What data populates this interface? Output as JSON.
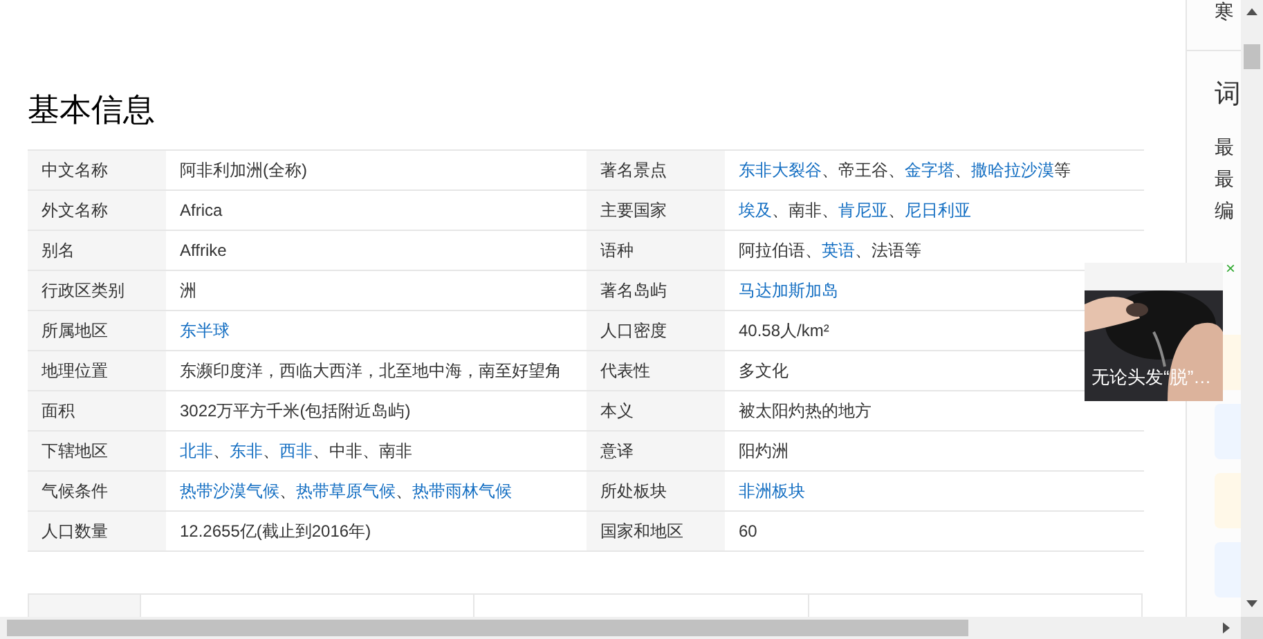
{
  "section_title": "基本信息",
  "info_rows": [
    {
      "left": {
        "label": "中文名称",
        "value": [
          {
            "text": "阿非利加洲(全称)",
            "link": false
          }
        ]
      },
      "right": {
        "label": "著名景点",
        "value": [
          {
            "text": "东非大裂谷",
            "link": true
          },
          {
            "text": "、帝王谷、",
            "link": false
          },
          {
            "text": "金字塔",
            "link": true
          },
          {
            "text": "、",
            "link": false
          },
          {
            "text": "撒哈拉沙漠",
            "link": true
          },
          {
            "text": "等",
            "link": false
          }
        ]
      }
    },
    {
      "left": {
        "label": "外文名称",
        "value": [
          {
            "text": "Africa",
            "link": false
          }
        ]
      },
      "right": {
        "label": "主要国家",
        "value": [
          {
            "text": "埃及",
            "link": true
          },
          {
            "text": "、南非、",
            "link": false
          },
          {
            "text": "肯尼亚",
            "link": true
          },
          {
            "text": "、",
            "link": false
          },
          {
            "text": "尼日利亚",
            "link": true
          }
        ]
      }
    },
    {
      "left": {
        "label": "别名",
        "value": [
          {
            "text": "Affrike",
            "link": false
          }
        ]
      },
      "right": {
        "label": "语种",
        "value": [
          {
            "text": "阿拉伯语、",
            "link": false
          },
          {
            "text": "英语",
            "link": true
          },
          {
            "text": "、法语等",
            "link": false
          }
        ]
      }
    },
    {
      "left": {
        "label": "行政区类别",
        "value": [
          {
            "text": "洲",
            "link": false
          }
        ]
      },
      "right": {
        "label": "著名岛屿",
        "value": [
          {
            "text": "马达加斯加岛",
            "link": true
          }
        ]
      }
    },
    {
      "left": {
        "label": "所属地区",
        "value": [
          {
            "text": "东半球",
            "link": true
          }
        ]
      },
      "right": {
        "label": "人口密度",
        "value": [
          {
            "text": "40.58人/km²",
            "link": false
          }
        ]
      }
    },
    {
      "left": {
        "label": "地理位置",
        "value": [
          {
            "text": "东濒印度洋，西临大西洋，北至地中海，南至好望角",
            "link": false
          }
        ]
      },
      "right": {
        "label": "代表性",
        "value": [
          {
            "text": "多文化",
            "link": false
          }
        ]
      }
    },
    {
      "left": {
        "label": "面积",
        "value": [
          {
            "text": "3022万平方千米(包括附近岛屿)",
            "link": false
          }
        ]
      },
      "right": {
        "label": "本义",
        "value": [
          {
            "text": "被太阳灼热的地方",
            "link": false
          }
        ]
      }
    },
    {
      "left": {
        "label": "下辖地区",
        "value": [
          {
            "text": "北非",
            "link": true
          },
          {
            "text": "、",
            "link": false
          },
          {
            "text": "东非",
            "link": true
          },
          {
            "text": "、",
            "link": false
          },
          {
            "text": "西非",
            "link": true
          },
          {
            "text": "、中非、南非",
            "link": false
          }
        ]
      },
      "right": {
        "label": "意译",
        "value": [
          {
            "text": "阳灼洲",
            "link": false
          }
        ]
      }
    },
    {
      "left": {
        "label": "气候条件",
        "value": [
          {
            "text": "热带沙漠气候",
            "link": true
          },
          {
            "text": "、",
            "link": false
          },
          {
            "text": "热带草原气候",
            "link": true
          },
          {
            "text": "、",
            "link": false
          },
          {
            "text": "热带雨林气候",
            "link": true
          }
        ]
      },
      "right": {
        "label": "所处板块",
        "value": [
          {
            "text": "非洲板块",
            "link": true
          }
        ]
      }
    },
    {
      "left": {
        "label": "人口数量",
        "value": [
          {
            "text": "12.2655亿(截止到2016年)",
            "link": false
          }
        ]
      },
      "right": {
        "label": "国家和地区",
        "value": [
          {
            "text": "60",
            "link": false
          }
        ]
      }
    }
  ],
  "sidebar": {
    "top_text": "寒",
    "heading": "词",
    "lines": [
      "最",
      "最",
      "编"
    ],
    "cards": [
      {
        "color": "#fff8e8"
      },
      {
        "color": "#eef5ff"
      },
      {
        "color": "#fff8e8"
      },
      {
        "color": "#eef5ff"
      }
    ]
  },
  "ad": {
    "caption": "无论头发“脱”…",
    "close": "×"
  }
}
